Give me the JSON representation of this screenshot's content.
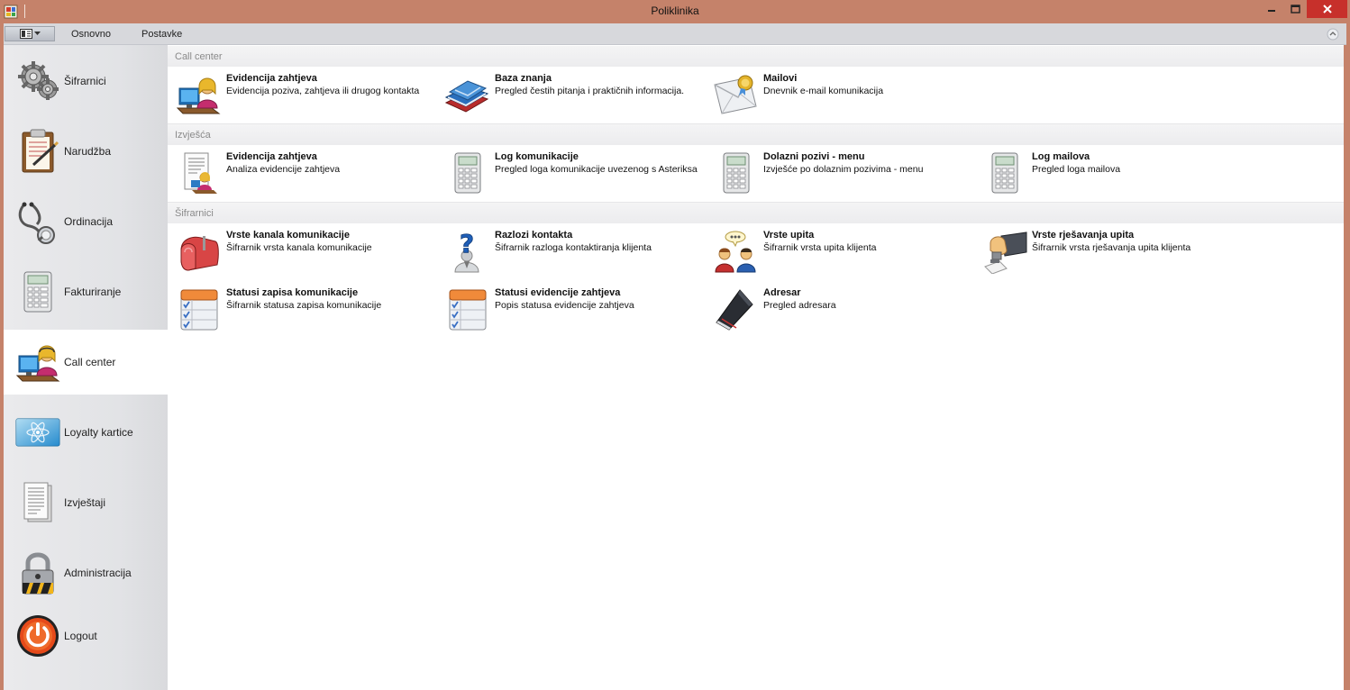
{
  "window": {
    "title": "Poliklinika"
  },
  "menu": {
    "tabs": [
      "Osnovno",
      "Postavke"
    ]
  },
  "nav": {
    "items": [
      {
        "label": "Šifrarnici",
        "icon": "gears-icon"
      },
      {
        "label": "Narudžba",
        "icon": "clipboard-icon"
      },
      {
        "label": "Ordinacija",
        "icon": "stethoscope-icon"
      },
      {
        "label": "Fakturiranje",
        "icon": "calculator-icon"
      },
      {
        "label": "Call center",
        "icon": "operator-icon"
      },
      {
        "label": "Loyalty kartice",
        "icon": "card-icon"
      },
      {
        "label": "Izvještaji",
        "icon": "report-icon"
      },
      {
        "label": "Administracija",
        "icon": "padlock-icon"
      },
      {
        "label": "Logout",
        "icon": "power-icon"
      }
    ],
    "active": "Call center"
  },
  "groups": [
    {
      "header": "Call center",
      "tiles": [
        {
          "title": "Evidencija zahtjeva",
          "desc": "Evidencija poziva, zahtjeva ili drugog kontakta",
          "icon": "operator-icon"
        },
        {
          "title": "Baza znanja",
          "desc": "Pregled čestih pitanja i praktičnih informacija.",
          "icon": "books-icon"
        },
        {
          "title": "Mailovi",
          "desc": "Dnevnik e-mail komunikacija",
          "icon": "envelope-icon"
        }
      ]
    },
    {
      "header": "Izvješća",
      "tiles": [
        {
          "title": "Evidencija zahtjeva",
          "desc": "Analiza evidencije zahtjeva",
          "icon": "report-user-icon"
        },
        {
          "title": "Log komunikacije",
          "desc": "Pregled loga komunikacije uvezenog s Asteriksa",
          "icon": "calculator-icon"
        },
        {
          "title": "Dolazni pozivi - menu",
          "desc": "Izvješće po dolaznim pozivima - menu",
          "icon": "calculator-icon"
        },
        {
          "title": "Log mailova",
          "desc": "Pregled loga mailova",
          "icon": "calculator-icon"
        }
      ]
    },
    {
      "header": "Šifrarnici",
      "tiles": [
        {
          "title": "Vrste kanala komunikacije",
          "desc": "Šifrarnik vrsta kanala komunikacije",
          "icon": "mailbox-icon"
        },
        {
          "title": "Razlozi kontakta",
          "desc": "Šifrarnik razloga kontaktiranja klijenta",
          "icon": "question-person-icon"
        },
        {
          "title": "Vrste upita",
          "desc": "Šifrarnik vrsta upita klijenta",
          "icon": "people-talk-icon"
        },
        {
          "title": "Vrste rješavanja upita",
          "desc": "Šifrarnik vrsta rješavanja upita klijenta",
          "icon": "stamp-icon"
        },
        {
          "title": "Statusi zapisa komunikacije",
          "desc": "Šifrarnik statusa zapisa komunikacije",
          "icon": "checklist-icon"
        },
        {
          "title": "Statusi evidencije zahtjeva",
          "desc": "Popis statusa evidencije zahtjeva",
          "icon": "checklist-icon"
        },
        {
          "title": "Adresar",
          "desc": "Pregled adresara",
          "icon": "address-book-icon"
        }
      ]
    }
  ]
}
